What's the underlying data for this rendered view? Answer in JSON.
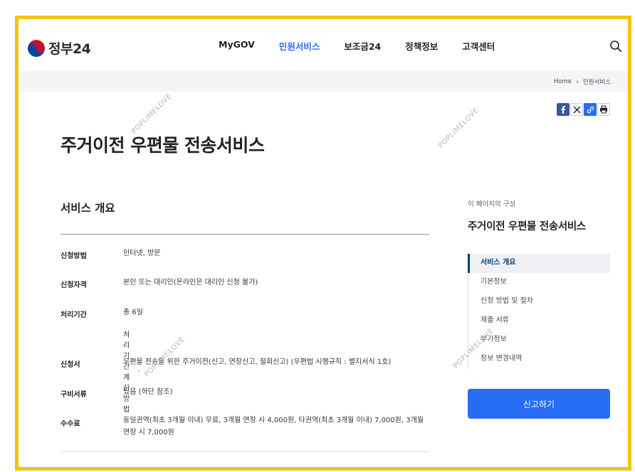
{
  "header": {
    "logo_text": "정부24",
    "nav": [
      "MyGOV",
      "민원서비스",
      "보조금24",
      "정책정보",
      "고객센터"
    ]
  },
  "breadcrumb": {
    "home": "Home",
    "current": "민원서비스"
  },
  "page_title": "주거이전 우편물 전송서비스",
  "section_title": "서비스 개요",
  "rows": [
    {
      "label": "신청방법",
      "value": "인터넷, 방문"
    },
    {
      "label": "신청자격",
      "value": "본인 또는 대리인(온라인은 대리인 신청 불가)"
    },
    {
      "label": "처리기간",
      "value": "총 6일",
      "link": "처리기간 계산 방법"
    },
    {
      "label": "신청서",
      "value": "우편물 전송을 위한 주거이전(신고, 연장신고, 철회신고) (우편법 시행규칙 : 별지서식 1호)"
    },
    {
      "label": "구비서류",
      "value": "있음 (하단 참조)"
    },
    {
      "label": "수수료",
      "value": "동일권역(최초 3개월 이내) 무료, 3개월 연장 시 4,000원, 타권역(최초 3개월 이내) 7,000원, 3개월 연장 시 7,000원"
    }
  ],
  "sidebar": {
    "caption": "이 페이지의 구성",
    "title": "주거이전 우편물 전송서비스",
    "toc": [
      "서비스 개요",
      "기본정보",
      "신청 방법 및 절차",
      "제출 서류",
      "부가정보",
      "정보 변경내역"
    ],
    "button_label": "신고하기"
  },
  "watermark": "POPLIMELOVE",
  "colors": {
    "accent": "#256ef4",
    "frame": "#f2c313",
    "toc_active": "#063a74"
  }
}
